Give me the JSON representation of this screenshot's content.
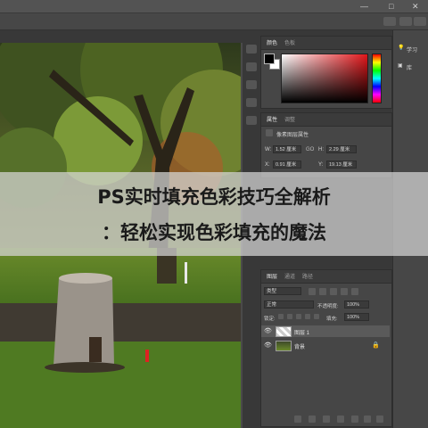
{
  "title_overlay": {
    "line1": "PS实时填充色彩技巧全解析",
    "line2": "：轻松实现色彩填充的魔法"
  },
  "color_panel": {
    "tabs": [
      "颜色",
      "色板"
    ],
    "fg_color": "#000000",
    "bg_color": "#ffffff",
    "hue_color": "#e2161a"
  },
  "properties_panel": {
    "tabs": [
      "属性",
      "调整"
    ],
    "section": "像素图层属性",
    "w_label": "W:",
    "w_value": "1.52 厘米",
    "h_label": "H:",
    "h_value": "2.29 厘米",
    "x_label": "X:",
    "x_value": "0.91 厘米",
    "y_label": "Y:",
    "y_value": "19.13 厘米",
    "link": "GO"
  },
  "layers_panel": {
    "tabs": [
      "图层",
      "通道",
      "路径"
    ],
    "filter": "类型",
    "blend_mode": "正常",
    "opacity_label": "不透明度:",
    "opacity_value": "100%",
    "lock_label": "锁定:",
    "fill_label": "填充:",
    "fill_value": "100%",
    "layers": [
      {
        "name": "图层 1",
        "selected": true
      },
      {
        "name": "背景",
        "selected": false
      }
    ]
  },
  "right_column": {
    "items": [
      "学习",
      "库"
    ]
  },
  "window": {
    "minimize": "—",
    "maximize": "□",
    "close": "✕"
  }
}
